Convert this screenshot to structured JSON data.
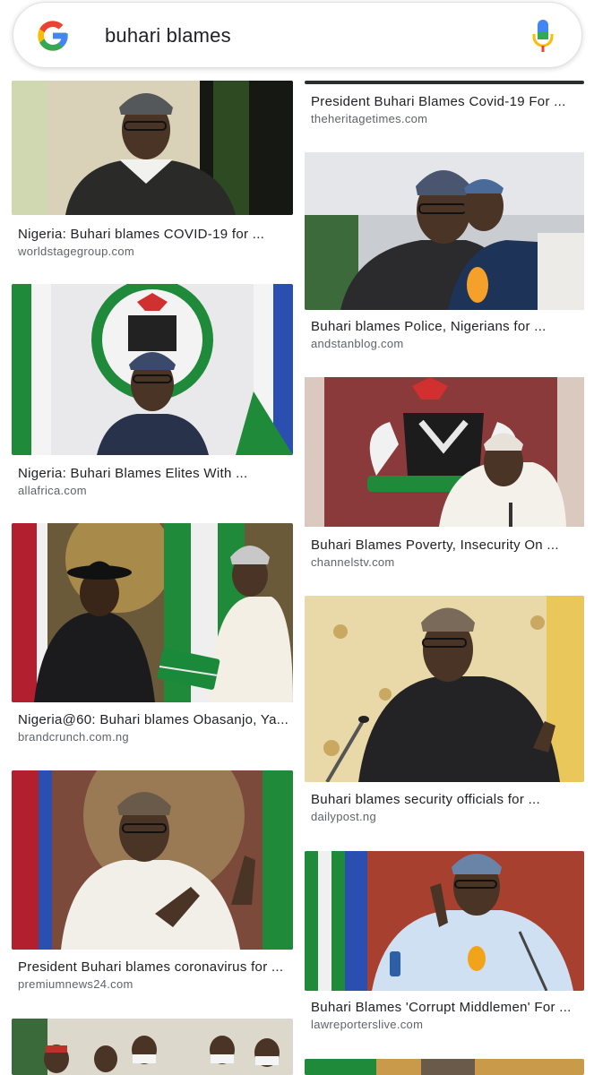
{
  "search": {
    "query": "buhari blames",
    "logo": "google-g-icon",
    "mic": "microphone-icon"
  },
  "colors": {
    "nigeria_green": "#1f8a3a",
    "google_blue": "#4285F4",
    "google_red": "#EA4335",
    "google_yellow": "#FBBC05",
    "google_green": "#34A853"
  },
  "left": [
    {
      "title": "Nigeria: Buhari blames COVID-19 for ...",
      "source": "worldstagegroup.com"
    },
    {
      "title": "Nigeria: Buhari Blames Elites With ...",
      "source": "allafrica.com"
    },
    {
      "title": "Nigeria@60: Buhari blames Obasanjo, Ya...",
      "source": "brandcrunch.com.ng"
    },
    {
      "title": "President Buhari blames coronavirus for ...",
      "source": "premiumnews24.com"
    }
  ],
  "right": [
    {
      "title": "President Buhari Blames Covid-19 For ...",
      "source": "theheritagetimes.com"
    },
    {
      "title": "Buhari blames Police, Nigerians for ...",
      "source": "andstanblog.com"
    },
    {
      "title": "Buhari Blames Poverty, Insecurity On ...",
      "source": "channelstv.com"
    },
    {
      "title": "Buhari blames security officials for ...",
      "source": "dailypost.ng"
    },
    {
      "title": "Buhari Blames 'Corrupt Middlemen' For ...",
      "source": "lawreporterslive.com"
    }
  ]
}
